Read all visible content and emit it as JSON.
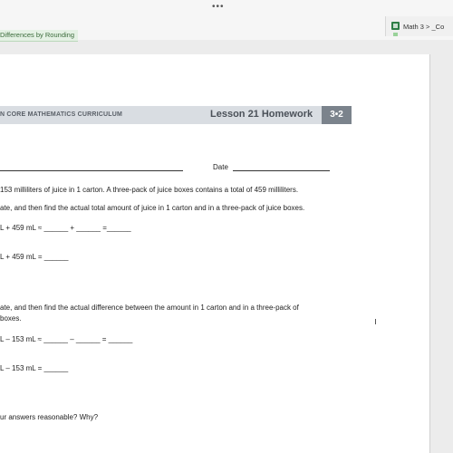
{
  "titlebar": {
    "more": "•••"
  },
  "tabs": {
    "active": "Differences by Rounding",
    "other": "Math 3 > _Co"
  },
  "worksheet": {
    "header_left": "N CORE MATHEMATICS CURRICULUM",
    "lesson_title": "Lesson 21 Homework",
    "badge": "3•2",
    "date_label": "Date",
    "problem": "153 milliliters of juice in 1 carton.  A three-pack of juice boxes contains a total of 459 milliliters.",
    "part_a": "ate, and then find the actual total amount of juice in 1 carton and in a three-pack of juice boxes.",
    "a_estimate": "L   + 459 mL ≈  ______   +  ______  =______",
    "a_actual": "L   + 459 mL  =  ______",
    "part_b_1": "ate, and then find the actual difference between the amount in 1 carton and in a three-pack of",
    "part_b_2": "boxes.",
    "b_estimate": "L  –  153 mL  ≈  ______  –  ______   =  ______",
    "b_actual": "L  –  153 mL  =  ______",
    "part_c": "ur answers reasonable?  Why?"
  },
  "colors": {
    "header_band": "#d9dde2",
    "badge_bg": "#7b838c",
    "tab_green": "#e4f1e4"
  }
}
